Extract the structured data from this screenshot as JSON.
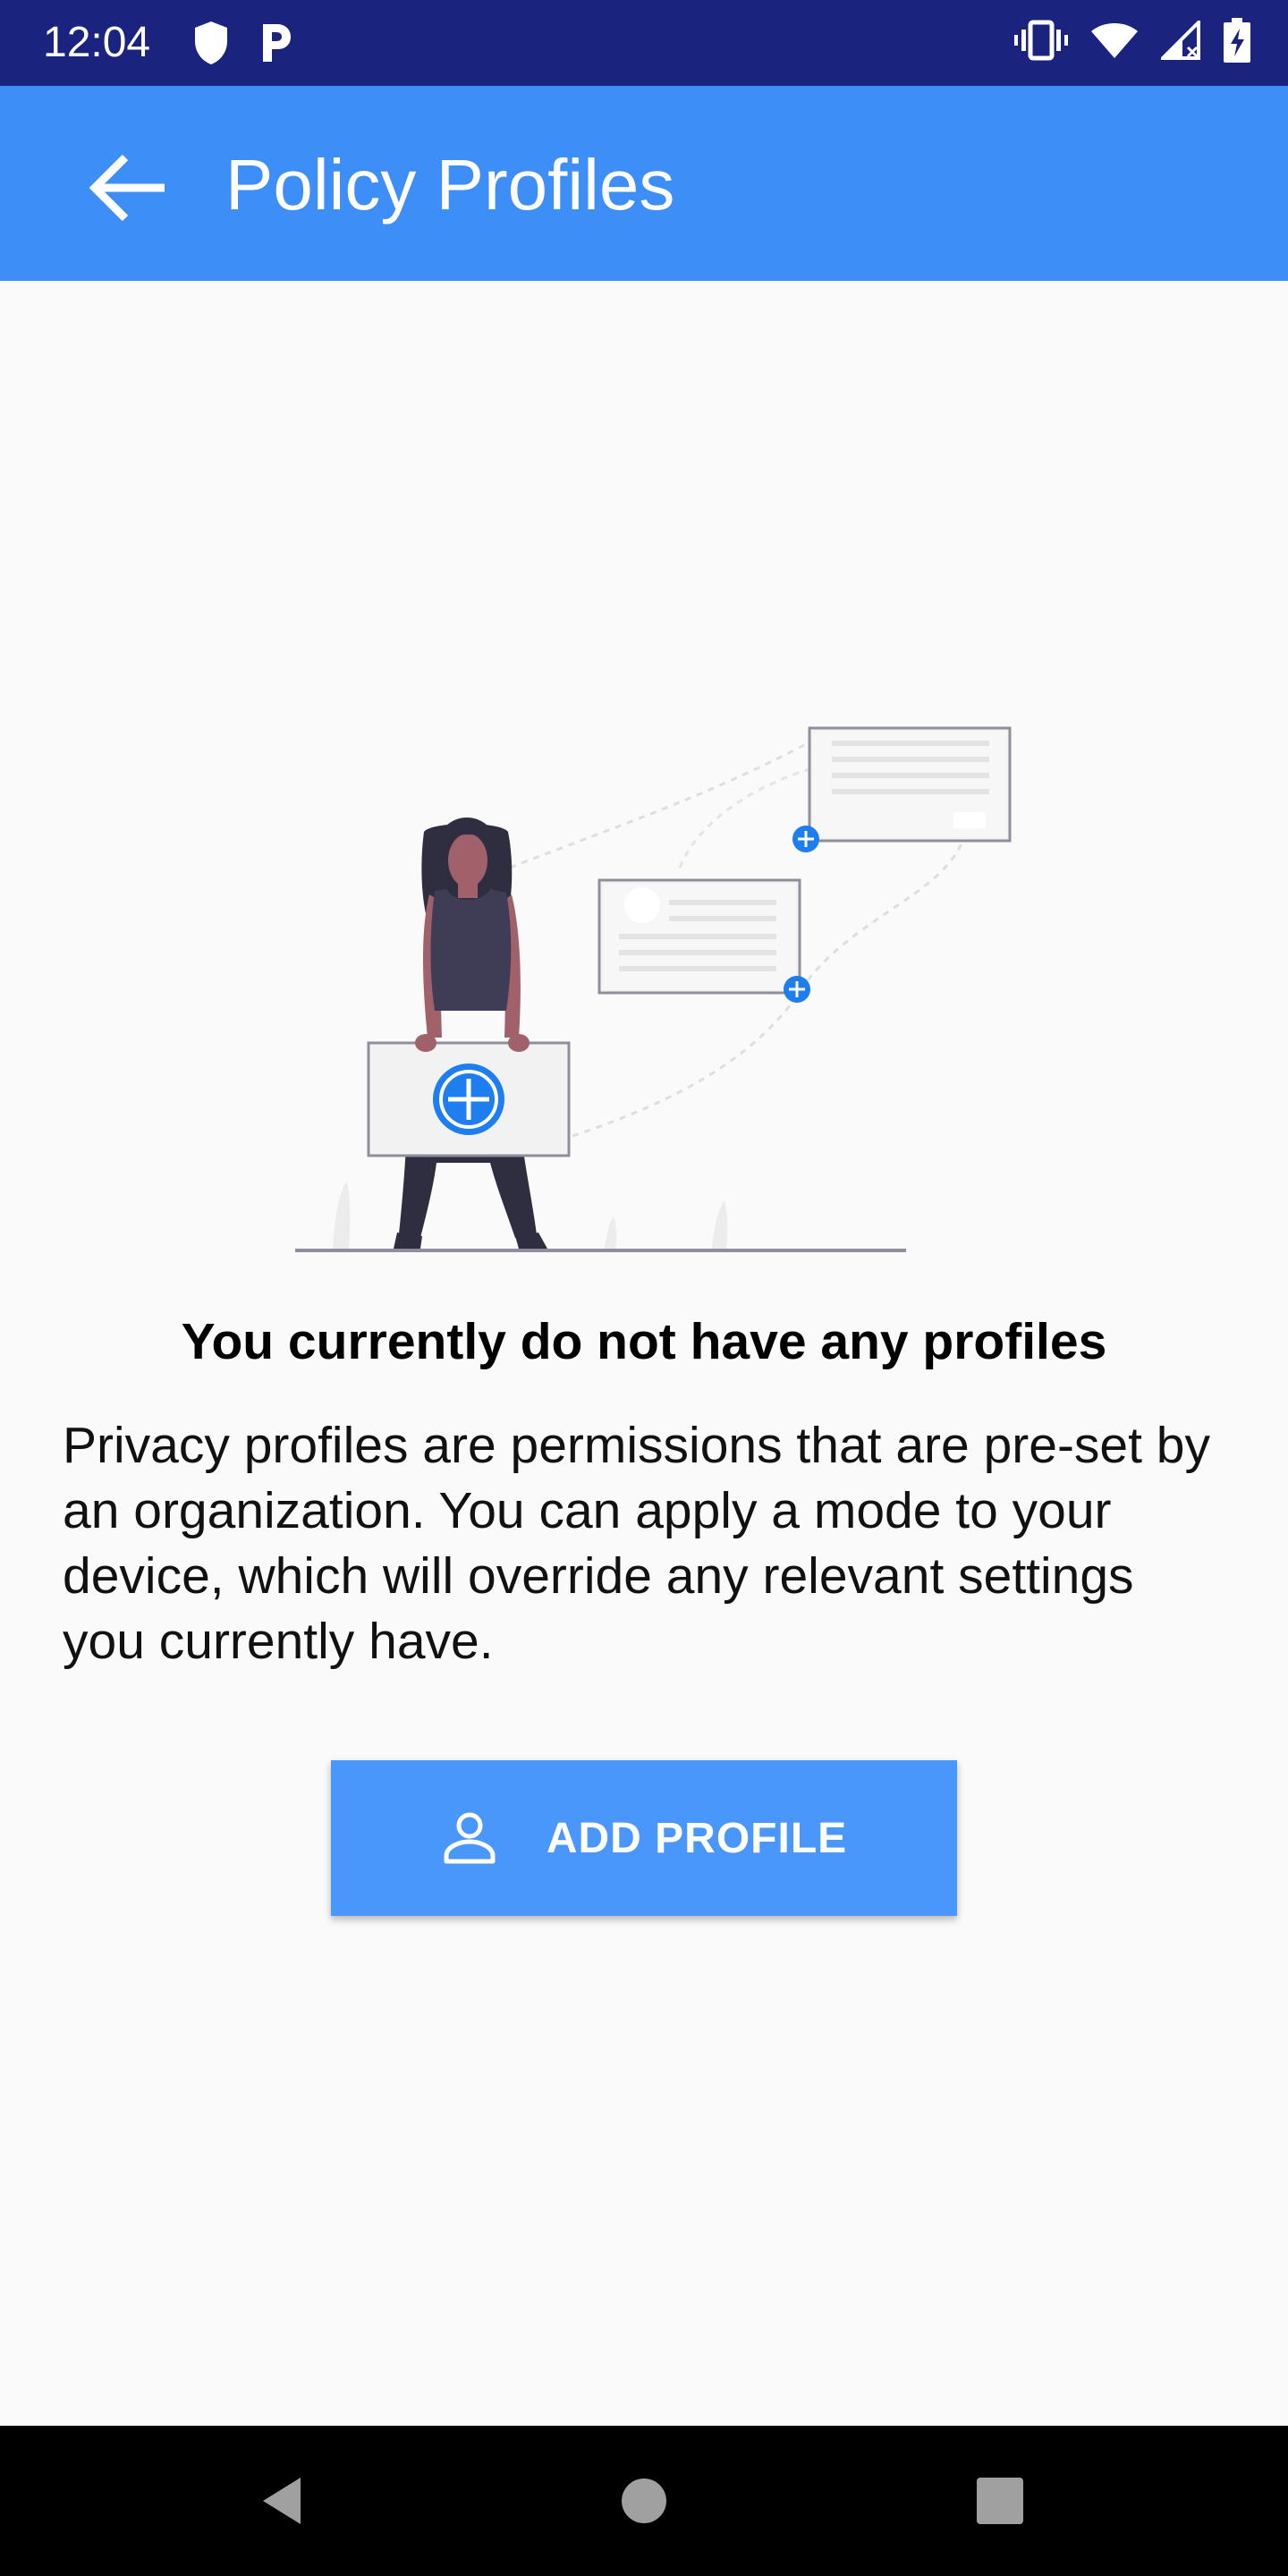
{
  "status_bar": {
    "time": "12:04",
    "left_icons": [
      "shield-icon",
      "parking-icon"
    ],
    "right_icons": [
      "vibrate-icon",
      "wifi-icon",
      "signal-icon",
      "battery-charging-icon"
    ]
  },
  "app_bar": {
    "title": "Policy Profiles",
    "back_icon": "arrow-back-icon",
    "background": "#3d8ef7"
  },
  "empty_state": {
    "heading": "You currently do not have any profiles",
    "description": "Privacy profiles are permissions that are pre-set by an organization. You can apply a mode to your device, which will override any relevant settings you currently have."
  },
  "add_button": {
    "label": "ADD PROFILE",
    "icon": "person-outline-icon",
    "background": "#4a97fb"
  },
  "colors": {
    "status_bar": "#1a237e",
    "accent": "#1e7ef0",
    "page_background": "#fafafa"
  },
  "nav_bar": {
    "buttons": [
      "back-triangle-icon",
      "home-circle-icon",
      "recents-square-icon"
    ]
  }
}
